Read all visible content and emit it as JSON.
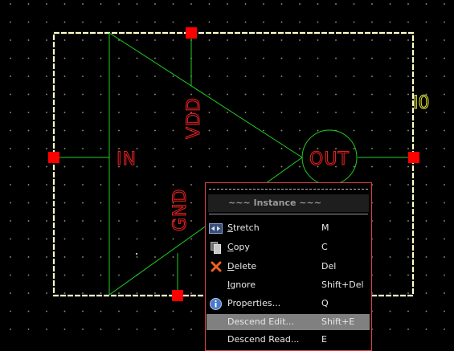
{
  "schematic": {
    "instance_name": "I0",
    "labels": {
      "in": "IN",
      "out": "OUT",
      "vdd": "VDD",
      "gnd": "GND"
    },
    "colors": {
      "background": "#000000",
      "body": "#ffffcc",
      "wire": "#22cc22",
      "pin": "#ff0000",
      "text": "#e02020",
      "instance_text": "#e8e83a"
    }
  },
  "context_menu": {
    "title": "~~~ Instance ~~~",
    "items": [
      {
        "label": "Stretch",
        "mnemonic": "S",
        "shortcut": "M",
        "icon": "stretch-icon"
      },
      {
        "label": "Copy",
        "mnemonic": "C",
        "shortcut": "C",
        "icon": "copy-icon"
      },
      {
        "label": "Delete",
        "mnemonic": "D",
        "shortcut": "Del",
        "icon": "delete-icon"
      },
      {
        "label": "Ignore",
        "mnemonic": "I",
        "shortcut": "Shift+Del",
        "icon": ""
      },
      {
        "label": "Properties...",
        "mnemonic": "",
        "shortcut": "Q",
        "icon": "info-icon"
      },
      {
        "label": "Descend Edit...",
        "mnemonic": "",
        "shortcut": "Shift+E",
        "icon": "",
        "active": true
      },
      {
        "label": "Descend Read...",
        "mnemonic": "",
        "shortcut": "E",
        "icon": ""
      }
    ]
  }
}
